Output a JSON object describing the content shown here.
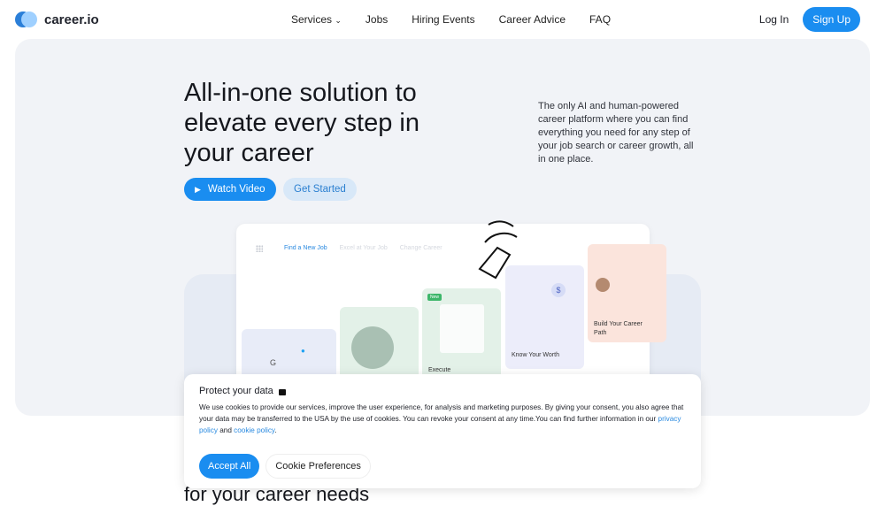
{
  "brand": {
    "name": "career.io"
  },
  "nav": {
    "items": [
      "Services",
      "Jobs",
      "Hiring Events",
      "Career Advice",
      "FAQ"
    ],
    "login": "Log In",
    "signup": "Sign Up"
  },
  "hero": {
    "title": "All-in-one solution to elevate every step in your career",
    "subtitle": "The only AI and human-powered career platform where you can find everything you need for any step of your job search or career growth, all in one place.",
    "watch_video": "Watch Video",
    "get_started": "Get Started",
    "mock": {
      "tabs": [
        "Find a New Job",
        "Excel at Your Job",
        "Change Career"
      ],
      "badge": "New",
      "cards": [
        "Execute",
        "Know Your Worth",
        "Build Your Career Path"
      ]
    }
  },
  "cookie": {
    "title": "Protect your data",
    "text": "We use cookies to provide our services, improve the user experience, for analysis and marketing purposes. By giving your consent, you also agree that your data may be transferred to the USA by the use of cookies. You can revoke your consent at any time.You can find further information in our ",
    "privacy_link": "privacy policy",
    "and": " and ",
    "cookie_link": "cookie policy",
    "end": ".",
    "accept": "Accept All",
    "preferences": "Cookie Preferences"
  },
  "section_heading_partial": "for your career needs",
  "colors": {
    "accent": "#1a8df0",
    "hero_bg": "#f1f3f7"
  }
}
